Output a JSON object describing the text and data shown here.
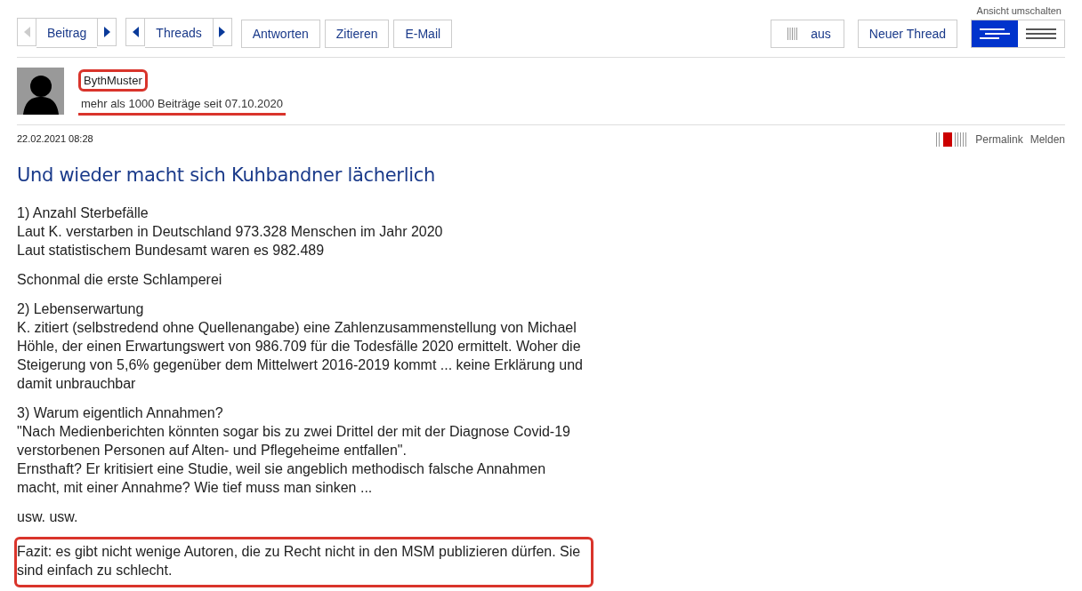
{
  "toolbar": {
    "post_nav": {
      "label": "Beitrag",
      "prev_disabled": true,
      "next_disabled": false
    },
    "thread_nav": {
      "label": "Threads",
      "prev_disabled": false,
      "next_disabled": false
    },
    "actions": [
      "Antworten",
      "Zitieren",
      "E-Mail"
    ],
    "rating_toggle": "aus",
    "new_thread": "Neuer Thread",
    "view_switch": {
      "label": "Ansicht umschalten",
      "options": [
        {
          "kind": "threaded",
          "selected": true
        },
        {
          "kind": "flat",
          "selected": false
        }
      ]
    }
  },
  "author": {
    "name": "BythMuster",
    "name_boxed": true,
    "meta": "mehr als 1000 Beiträge seit 07.10.2020",
    "meta_underlined": true
  },
  "post": {
    "date": "22.02.2021 08:28",
    "links": [
      "Permalink",
      "Melden"
    ],
    "title": "Und wieder macht sich Kuhbandner lächerlich",
    "paragraphs": [
      {
        "boxed": false,
        "lines": [
          "1) Anzahl Sterbefälle",
          "Laut K. verstarben in Deutschland 973.328 Menschen im Jahr 2020",
          "Laut statistischem Bundesamt waren es 982.489"
        ]
      },
      {
        "boxed": false,
        "lines": [
          "Schonmal die erste Schlamperei"
        ]
      },
      {
        "boxed": false,
        "lines": [
          "2) Lebenserwartung",
          "K. zitiert (selbstredend ohne Quellenangabe) eine Zahlenzusammenstellung von Michael",
          "Höhle, der einen Erwartungswert von 986.709 für die Todesfälle 2020 ermittelt. Woher die",
          "Steigerung von 5,6% gegenüber dem Mittelwert 2016-2019 kommt ... keine Erklärung und",
          "damit unbrauchbar"
        ]
      },
      {
        "boxed": false,
        "lines": [
          "3) Warum eigentlich Annahmen?",
          "\"Nach Medienberichten könnten sogar bis zu zwei Drittel der mit der Diagnose Covid-19",
          "verstorbenen Personen auf Alten- und Pflegeheime entfallen\".",
          "Ernsthaft? Er kritisiert eine Studie, weil sie angeblich methodisch falsche Annahmen",
          "macht, mit einer Annahme? Wie tief muss man sinken ..."
        ]
      },
      {
        "boxed": false,
        "lines": [
          "usw. usw."
        ]
      },
      {
        "boxed": true,
        "lines": [
          "Fazit: es gibt nicht wenige Autoren, die zu Recht nicht in den MSM publizieren dürfen. Sie",
          "sind einfach zu schlecht."
        ]
      }
    ]
  }
}
